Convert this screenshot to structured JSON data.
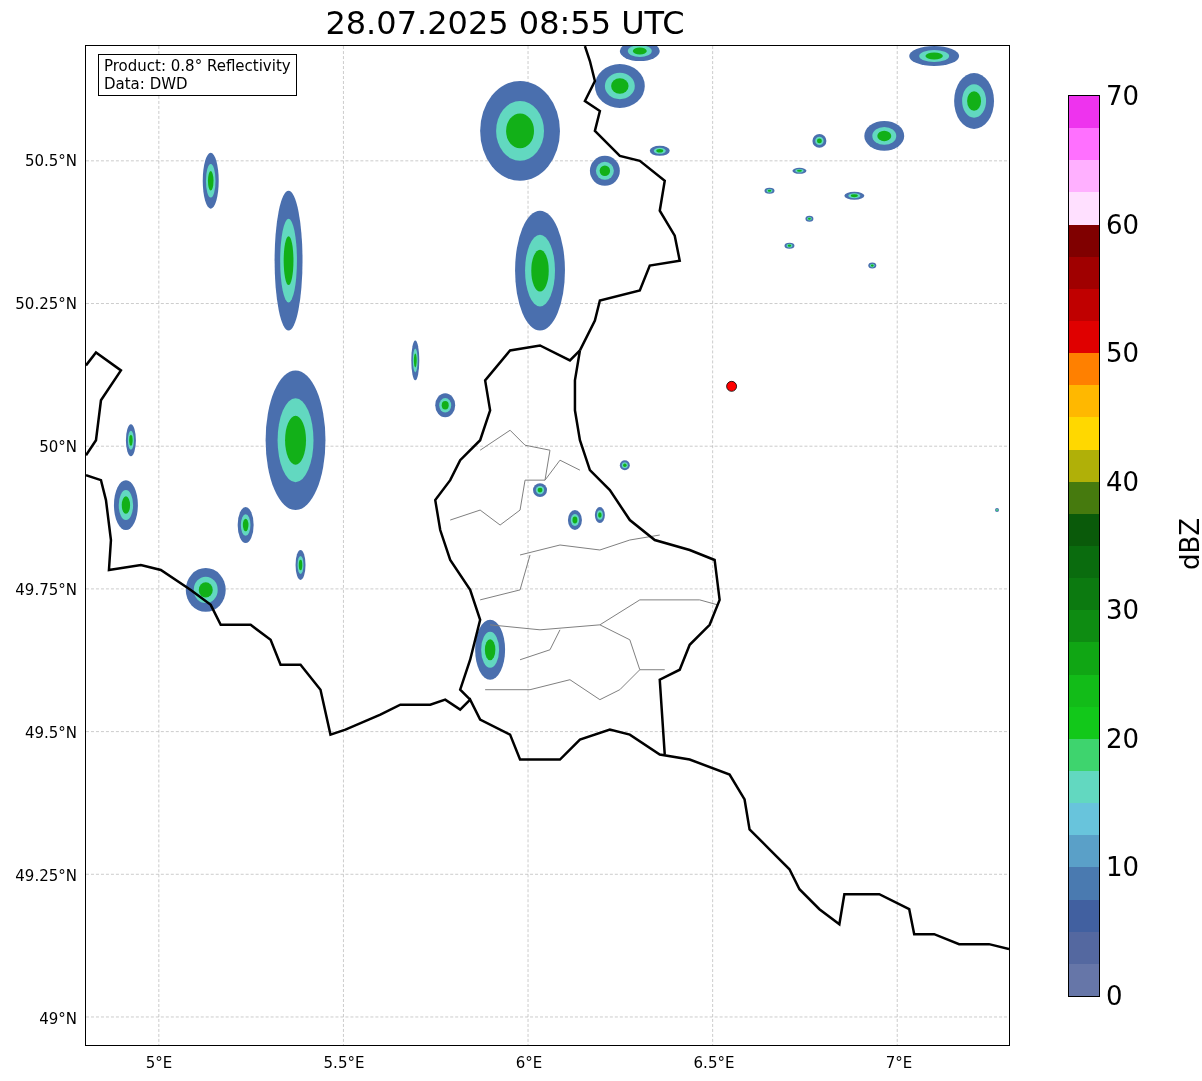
{
  "title": "28.07.2025 08:55 UTC",
  "map": {
    "legend": [
      "Product: 0.8° Reflectivity",
      "Data: DWD"
    ],
    "xticks": [
      "5°E",
      "5.5°E",
      "6°E",
      "6.5°E",
      "7°E"
    ],
    "yticks": [
      "50.5°N",
      "50.25°N",
      "50°N",
      "49.75°N",
      "49.5°N",
      "49.25°N",
      "49°N"
    ]
  },
  "colorbar": {
    "label": "dBZ",
    "ticks": [
      "70",
      "60",
      "50",
      "40",
      "30",
      "20",
      "10",
      "0"
    ],
    "segments": [
      {
        "color": "#6676a8"
      },
      {
        "color": "#5468a0"
      },
      {
        "color": "#4160a0"
      },
      {
        "color": "#4a7ab0"
      },
      {
        "color": "#5aa0c8"
      },
      {
        "color": "#68c4dc"
      },
      {
        "color": "#62d8c0"
      },
      {
        "color": "#3ed46e"
      },
      {
        "color": "#12c81a"
      },
      {
        "color": "#12bc18"
      },
      {
        "color": "#10a614"
      },
      {
        "color": "#0e8c12"
      },
      {
        "color": "#0c7a10"
      },
      {
        "color": "#0a6c0e"
      },
      {
        "color": "#0a5a0a"
      },
      {
        "color": "#467a0e"
      },
      {
        "color": "#b0b008"
      },
      {
        "color": "#ffd800"
      },
      {
        "color": "#ffb800"
      },
      {
        "color": "#ff8000"
      },
      {
        "color": "#e00000"
      },
      {
        "color": "#c00000"
      },
      {
        "color": "#a00000"
      },
      {
        "color": "#800000"
      },
      {
        "color": "#ffe0ff"
      },
      {
        "color": "#ffb0ff"
      },
      {
        "color": "#ff70ff"
      },
      {
        "color": "#ee33ee"
      }
    ]
  }
}
